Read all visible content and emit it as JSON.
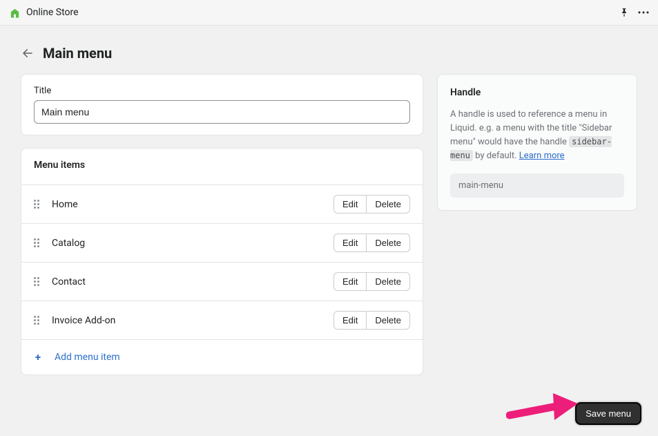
{
  "topbar": {
    "title": "Online Store"
  },
  "header": {
    "page_title": "Main menu"
  },
  "title_card": {
    "label": "Title",
    "value": "Main menu"
  },
  "menu_card": {
    "heading": "Menu items",
    "items": [
      {
        "label": "Home",
        "edit": "Edit",
        "delete": "Delete"
      },
      {
        "label": "Catalog",
        "edit": "Edit",
        "delete": "Delete"
      },
      {
        "label": "Contact",
        "edit": "Edit",
        "delete": "Delete"
      },
      {
        "label": "Invoice Add-on",
        "edit": "Edit",
        "delete": "Delete"
      }
    ],
    "add_label": "Add menu item"
  },
  "handle_card": {
    "title": "Handle",
    "desc_pre": "A handle is used to reference a menu in Liquid. e.g. a menu with the title \"Sidebar menu\" would have the handle ",
    "desc_code": "sidebar-menu",
    "desc_post": " by default. ",
    "learn_more": "Learn more",
    "value": "main-menu"
  },
  "footer": {
    "save_label": "Save menu"
  }
}
